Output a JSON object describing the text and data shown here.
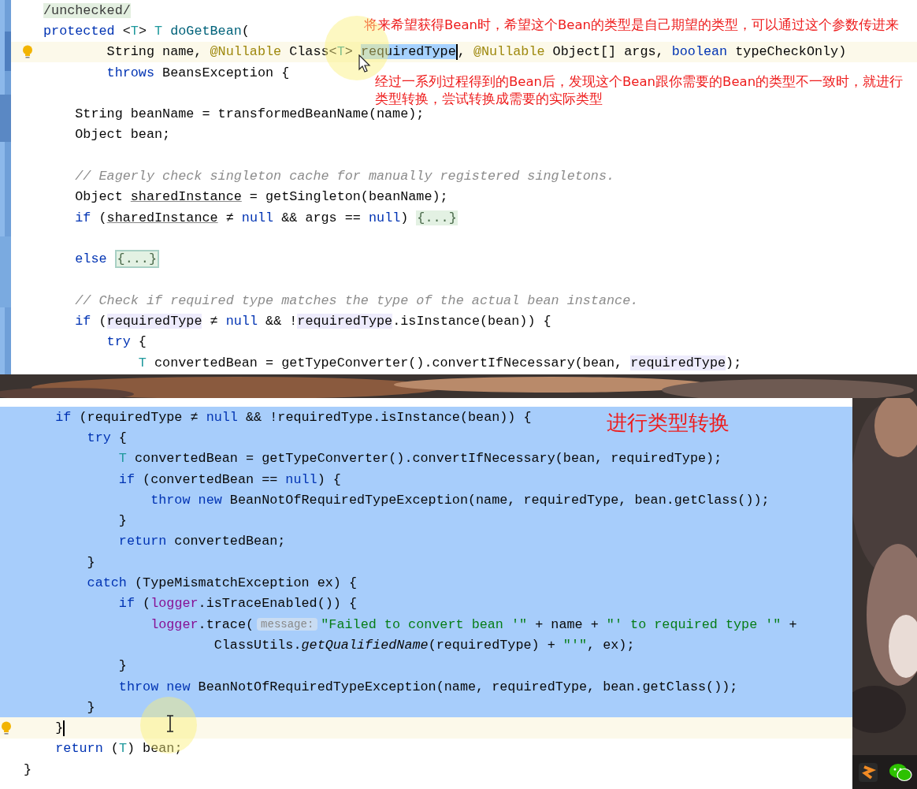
{
  "editors": [
    {
      "notes": [
        "将来希望获得Bean时，希望这个Bean的类型是自己期望的类型，可以通过这个参数传进来",
        "经过一系列过程得到的Bean后，发现这个Bean跟你需要的Bean的类型不一致时，就进行类型转换，尝试转换成需要的实际类型"
      ],
      "lines": [
        {
          "selected": false,
          "current": false,
          "tokens": [
            {
              "kind": "dim",
              "text": "/unchecked/"
            }
          ]
        },
        {
          "selected": false,
          "current": false,
          "tokens": [
            {
              "kind": "kw",
              "text": "protected"
            },
            {
              "kind": "p",
              "text": " <"
            },
            {
              "kind": "tp",
              "text": "T"
            },
            {
              "kind": "p",
              "text": "> "
            },
            {
              "kind": "tp",
              "text": "T"
            },
            {
              "kind": "fn",
              "text": " doGetBean"
            },
            {
              "kind": "p",
              "text": "("
            }
          ]
        },
        {
          "selected": false,
          "current": true,
          "tokens": [
            {
              "kind": "p",
              "text": "        String name, "
            },
            {
              "kind": "ann",
              "text": "@Nullable"
            },
            {
              "kind": "p",
              "text": " Class<"
            },
            {
              "kind": "tp",
              "text": "T"
            },
            {
              "kind": "p",
              "text": "> "
            },
            {
              "kind": "sel",
              "text": "requiredType"
            },
            {
              "kind": "caret"
            },
            {
              "kind": "p",
              "text": ", "
            },
            {
              "kind": "ann",
              "text": "@Nullable"
            },
            {
              "kind": "p",
              "text": " Object[] args, "
            },
            {
              "kind": "kw",
              "text": "boolean"
            },
            {
              "kind": "p",
              "text": " typeCheckOnly)"
            }
          ]
        },
        {
          "selected": false,
          "current": false,
          "tokens": [
            {
              "kind": "kw",
              "text": "        throws"
            },
            {
              "kind": "p",
              "text": " BeansException {"
            }
          ]
        },
        {
          "selected": false,
          "current": false
        },
        {
          "selected": false,
          "current": false,
          "tokens": [
            {
              "kind": "p",
              "text": "    String beanName = transformedBeanName(name);"
            }
          ]
        },
        {
          "selected": false,
          "current": false,
          "tokens": [
            {
              "kind": "p",
              "text": "    Object bean;"
            }
          ]
        },
        {
          "selected": false,
          "current": false
        },
        {
          "selected": false,
          "current": false,
          "tokens": [
            {
              "kind": "cmt",
              "text": "    // Eagerly check singleton cache for manually registered singletons."
            }
          ]
        },
        {
          "selected": false,
          "current": false,
          "tokens": [
            {
              "kind": "p",
              "text": "    Object "
            },
            {
              "kind": "ul",
              "text": "sharedInstance"
            },
            {
              "kind": "p",
              "text": " = getSingleton(beanName);"
            }
          ]
        },
        {
          "selected": false,
          "current": false,
          "tokens": [
            {
              "kind": "kw",
              "text": "    if"
            },
            {
              "kind": "p",
              "text": " ("
            },
            {
              "kind": "ul",
              "text": "sharedInstance"
            },
            {
              "kind": "p",
              "text": " ≠ "
            },
            {
              "kind": "kw",
              "text": "null"
            },
            {
              "kind": "p",
              "text": " && args == "
            },
            {
              "kind": "kw",
              "text": "null"
            },
            {
              "kind": "p",
              "text": ")"
            },
            {
              "kind": "fold",
              "text": "{...}"
            }
          ]
        },
        {
          "selected": false,
          "current": false
        },
        {
          "selected": false,
          "current": false,
          "tokens": [
            {
              "kind": "kw",
              "text": "    else"
            },
            {
              "kind": "foldbox",
              "text": "{...}"
            }
          ]
        },
        {
          "selected": false,
          "current": false
        },
        {
          "selected": false,
          "current": false,
          "tokens": [
            {
              "kind": "cmt",
              "text": "    // Check if required type matches the type of the actual bean instance."
            }
          ]
        },
        {
          "selected": false,
          "current": false,
          "tokens": [
            {
              "kind": "kw",
              "text": "    if"
            },
            {
              "kind": "p",
              "text": " ("
            },
            {
              "kind": "ref",
              "text": "requiredType"
            },
            {
              "kind": "p",
              "text": " ≠ "
            },
            {
              "kind": "kw",
              "text": "null"
            },
            {
              "kind": "p",
              "text": " && !"
            },
            {
              "kind": "ref",
              "text": "requiredType"
            },
            {
              "kind": "p",
              "text": ".isInstance(bean)) {"
            }
          ]
        },
        {
          "selected": false,
          "current": false,
          "tokens": [
            {
              "kind": "kw",
              "text": "        try"
            },
            {
              "kind": "p",
              "text": " {"
            }
          ]
        },
        {
          "selected": false,
          "current": false,
          "tokens": [
            {
              "kind": "tp",
              "text": "            T"
            },
            {
              "kind": "p",
              "text": " convertedBean = getTypeConverter().convertIfNecessary(bean, "
            },
            {
              "kind": "ref",
              "text": "requiredType"
            },
            {
              "kind": "p",
              "text": ");"
            }
          ]
        }
      ]
    },
    {
      "notes": [
        "进行类型转换"
      ],
      "lines": [
        {
          "selected": true,
          "current": false,
          "tokens": [
            {
              "kind": "kw",
              "text": "    if"
            },
            {
              "kind": "p",
              "text": " (requiredType ≠ "
            },
            {
              "kind": "kw",
              "text": "null"
            },
            {
              "kind": "p",
              "text": " && !requiredType.isInstance(bean)) {"
            }
          ]
        },
        {
          "selected": true,
          "current": false,
          "tokens": [
            {
              "kind": "kw",
              "text": "        try"
            },
            {
              "kind": "p",
              "text": " {"
            }
          ]
        },
        {
          "selected": true,
          "current": false,
          "tokens": [
            {
              "kind": "tp",
              "text": "            T"
            },
            {
              "kind": "p",
              "text": " convertedBean = getTypeConverter().convertIfNecessary(bean, requiredType);"
            }
          ]
        },
        {
          "selected": true,
          "current": false,
          "tokens": [
            {
              "kind": "kw",
              "text": "            if"
            },
            {
              "kind": "p",
              "text": " (convertedBean == "
            },
            {
              "kind": "kw",
              "text": "null"
            },
            {
              "kind": "p",
              "text": ") {"
            }
          ]
        },
        {
          "selected": true,
          "current": false,
          "tokens": [
            {
              "kind": "kw",
              "text": "                throw new"
            },
            {
              "kind": "p",
              "text": " BeanNotOfRequiredTypeException(name, requiredType, bean.getClass());"
            }
          ]
        },
        {
          "selected": true,
          "current": false,
          "tokens": [
            {
              "kind": "p",
              "text": "            }"
            }
          ]
        },
        {
          "selected": true,
          "current": false,
          "tokens": [
            {
              "kind": "kw",
              "text": "            return"
            },
            {
              "kind": "p",
              "text": " convertedBean;"
            }
          ]
        },
        {
          "selected": true,
          "current": false,
          "tokens": [
            {
              "kind": "p",
              "text": "        }"
            }
          ]
        },
        {
          "selected": true,
          "current": false,
          "tokens": [
            {
              "kind": "kw",
              "text": "        catch"
            },
            {
              "kind": "p",
              "text": " (TypeMismatchException ex) {"
            }
          ]
        },
        {
          "selected": true,
          "current": false,
          "tokens": [
            {
              "kind": "kw",
              "text": "            if"
            },
            {
              "kind": "p",
              "text": " ("
            },
            {
              "kind": "fld",
              "text": "logger"
            },
            {
              "kind": "p",
              "text": ".isTraceEnabled()) {"
            }
          ]
        },
        {
          "selected": true,
          "current": false,
          "tokens": [
            {
              "kind": "fld",
              "text": "                logger"
            },
            {
              "kind": "p",
              "text": ".trace("
            },
            {
              "kind": "hint",
              "text": "message:"
            },
            {
              "kind": "str",
              "text": "\"Failed to convert bean '\""
            },
            {
              "kind": "p",
              "text": " + name + "
            },
            {
              "kind": "str",
              "text": "\"' to required type '\""
            },
            {
              "kind": "p",
              "text": " +"
            }
          ]
        },
        {
          "selected": true,
          "current": false,
          "tokens": [
            {
              "kind": "p",
              "text": "                        ClassUtils."
            },
            {
              "kind": "it",
              "text": "getQualifiedName"
            },
            {
              "kind": "p",
              "text": "(requiredType) + "
            },
            {
              "kind": "str",
              "text": "\"'\""
            },
            {
              "kind": "p",
              "text": ", ex);"
            }
          ]
        },
        {
          "selected": true,
          "current": false,
          "tokens": [
            {
              "kind": "p",
              "text": "            }"
            }
          ]
        },
        {
          "selected": true,
          "current": false,
          "tokens": [
            {
              "kind": "kw",
              "text": "            throw new"
            },
            {
              "kind": "p",
              "text": " BeanNotOfRequiredTypeException(name, requiredType, bean.getClass());"
            }
          ]
        },
        {
          "selected": true,
          "current": false,
          "tokens": [
            {
              "kind": "p",
              "text": "        }"
            }
          ]
        },
        {
          "selected": false,
          "current": true,
          "tokens": [
            {
              "kind": "p",
              "text": "    }"
            },
            {
              "kind": "caret"
            }
          ]
        },
        {
          "selected": false,
          "current": false,
          "tokens": [
            {
              "kind": "kw",
              "text": "    return"
            },
            {
              "kind": "p",
              "text": " ("
            },
            {
              "kind": "tp",
              "text": "T"
            },
            {
              "kind": "p",
              "text": ") bean;"
            }
          ]
        },
        {
          "selected": false,
          "current": false,
          "tokens": [
            {
              "kind": "p",
              "text": "}"
            }
          ]
        }
      ]
    }
  ]
}
